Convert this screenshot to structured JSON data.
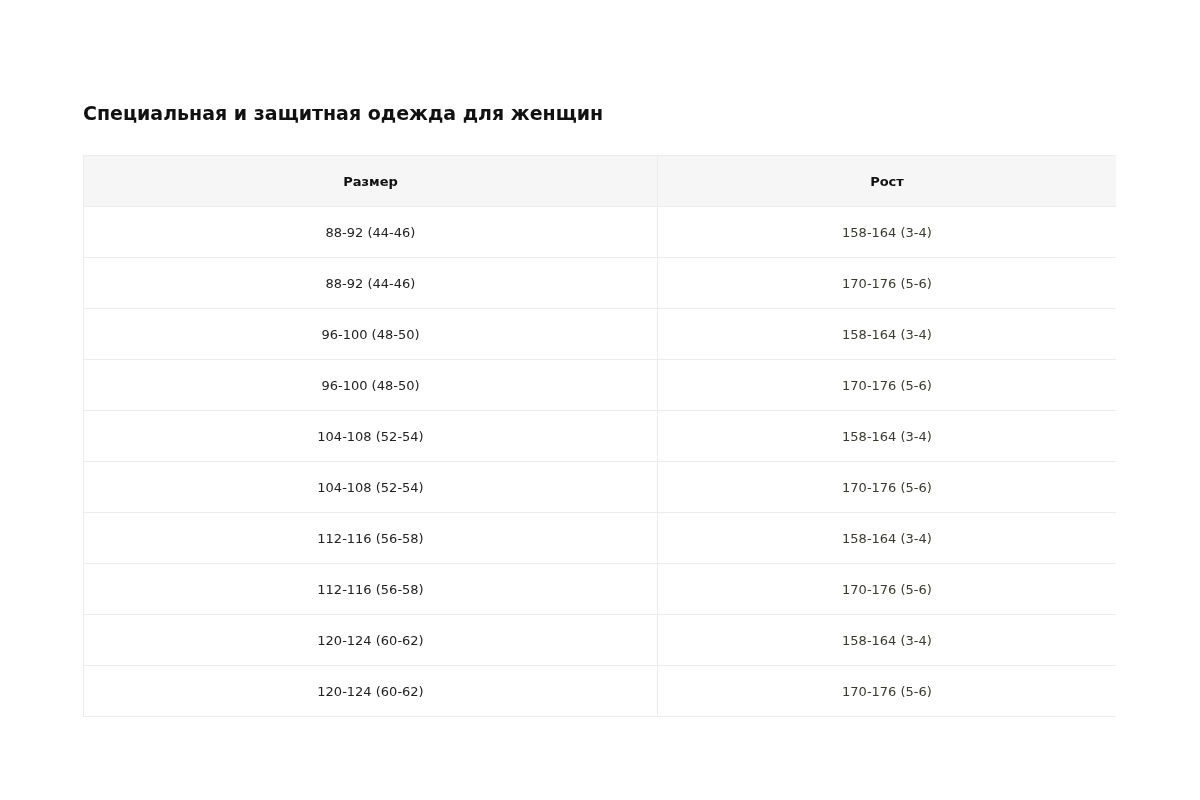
{
  "title": "Специальная и защитная одежда для женщин",
  "table": {
    "columns": [
      "Размер",
      "Рост"
    ],
    "rows": [
      [
        "88-92 (44-46)",
        "158-164 (3-4)"
      ],
      [
        "88-92 (44-46)",
        "170-176 (5-6)"
      ],
      [
        "96-100 (48-50)",
        "158-164 (3-4)"
      ],
      [
        "96-100 (48-50)",
        "170-176 (5-6)"
      ],
      [
        "104-108 (52-54)",
        "158-164 (3-4)"
      ],
      [
        "104-108 (52-54)",
        "170-176 (5-6)"
      ],
      [
        "112-116 (56-58)",
        "158-164 (3-4)"
      ],
      [
        "112-116 (56-58)",
        "170-176 (5-6)"
      ],
      [
        "120-124 (60-62)",
        "158-164 (3-4)"
      ],
      [
        "120-124 (60-62)",
        "170-176 (5-6)"
      ]
    ]
  }
}
